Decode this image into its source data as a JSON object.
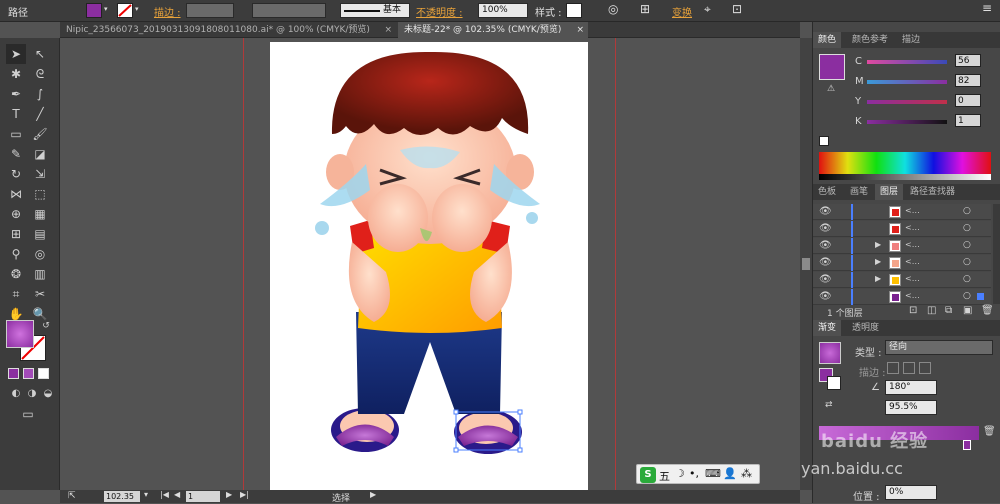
{
  "control_bar": {
    "object_type": "路径",
    "stroke_label": "描边 :",
    "stroke_profile": "基本",
    "opacity_label": "不透明度 :",
    "opacity_value": "100%",
    "style_label": "样式 :",
    "transform_label": "变换"
  },
  "tabs": [
    {
      "label": "Nipic_23566073_20190313091808011080.ai* @ 100% (CMYK/预览)",
      "close": "×"
    },
    {
      "label": "未标题-22* @ 102.35% (CMYK/预览)",
      "close": "×"
    }
  ],
  "color_panel": {
    "tabs": [
      "颜色",
      "颜色参考",
      "描边"
    ],
    "channels": [
      {
        "name": "C",
        "value": "56"
      },
      {
        "name": "M",
        "value": "82"
      },
      {
        "name": "Y",
        "value": "0"
      },
      {
        "name": "K",
        "value": "1"
      }
    ],
    "fill_color": "#8b2ea0"
  },
  "layers_panel": {
    "tabs": [
      "色板",
      "画笔",
      "图层",
      "路径查找器"
    ],
    "rows": 6,
    "footer": "1 个图层"
  },
  "gradient_panel": {
    "tabs": [
      "渐变",
      "透明度"
    ],
    "type_label": "类型 :",
    "type_value": "径向",
    "stroke_label": "描边 :",
    "angle_value": "180°",
    "aspect_value": "95.5%",
    "location_label": "位置 :",
    "location_value": "0%"
  },
  "status_bar": {
    "zoom": "102.35",
    "page": "1",
    "tool": "选择"
  },
  "watermark": {
    "brand_text": "baidu 经验",
    "url_text": "yan.baidu.cc"
  },
  "ime_bar": {
    "label": "五"
  }
}
